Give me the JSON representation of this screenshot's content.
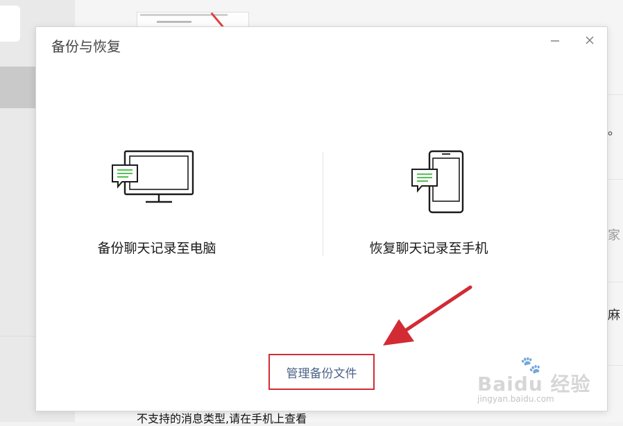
{
  "dialog": {
    "title": "备份与恢复",
    "minimize_glyph": "—",
    "close_glyph": "✕",
    "options": [
      {
        "label": "备份聊天记录至电脑",
        "icon": "monitor-chat-icon"
      },
      {
        "label": "恢复聊天记录至手机",
        "icon": "phone-chat-icon"
      }
    ],
    "manage_link": "管理备份文件"
  },
  "background": {
    "bottom_message": "不支持的消息类型,请在手机上查看",
    "fragments": [
      "。",
      "家",
      "麻"
    ]
  },
  "watermark": {
    "text": "Baidu 经验",
    "url": "jingyan.baidu.com"
  },
  "colors": {
    "accent_green": "#3eb93e",
    "highlight_red": "#d22b34",
    "link_blue": "#4b6287"
  }
}
